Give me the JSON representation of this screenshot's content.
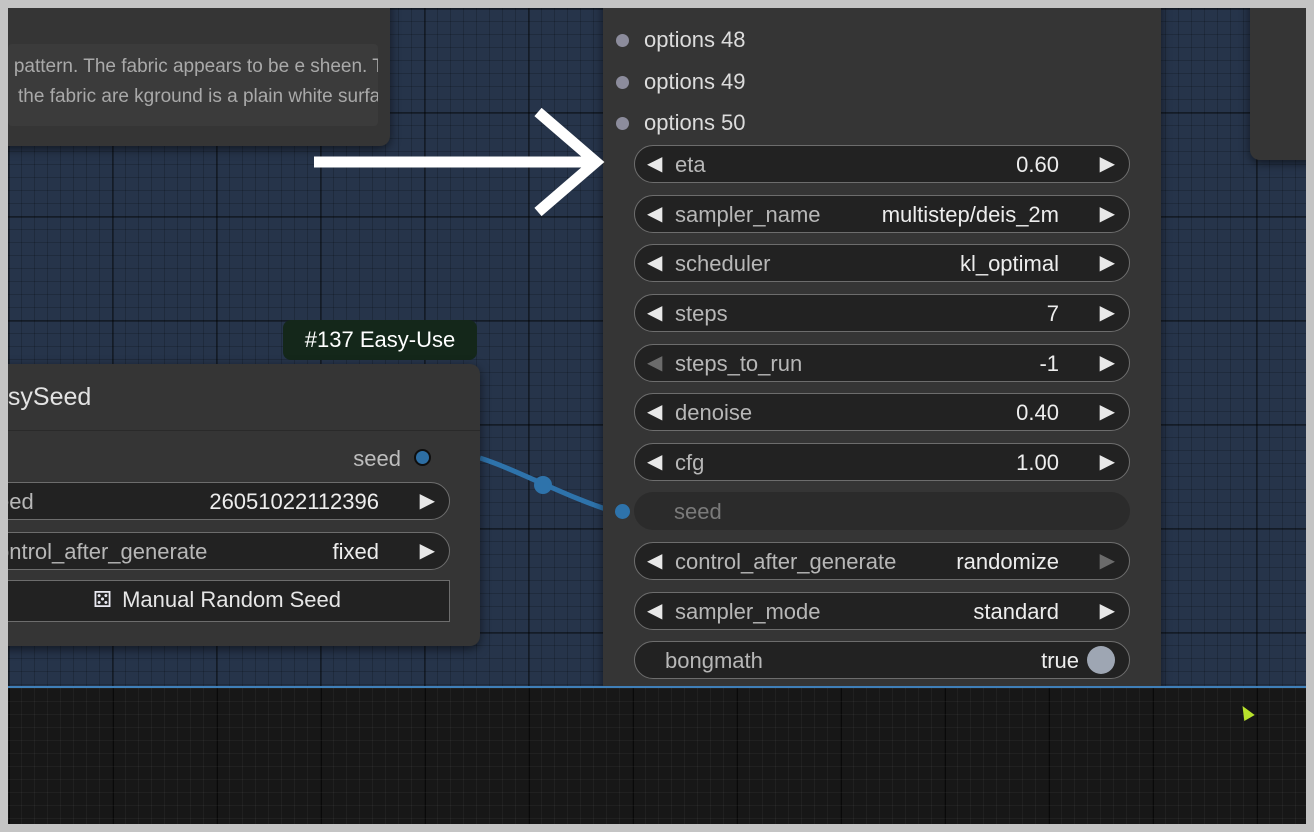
{
  "note_node": {
    "text": "d pattern. The fabric appears to be e sheen. The edges of the fabric are kground is a plain white surface, and"
  },
  "easy_seed_node": {
    "badge": "#137 Easy-Use",
    "title": "asySeed",
    "output_label": "seed",
    "seed_widget": {
      "label": "eed",
      "value": "26051022112396"
    },
    "control_widget": {
      "label": "ontrol_after_generate",
      "value": "fixed"
    },
    "manual_button": "Manual Random Seed",
    "dice_icon": "dice-icon"
  },
  "sampler_node": {
    "options": [
      {
        "label": "options 48"
      },
      {
        "label": "options 49"
      },
      {
        "label": "options 50"
      }
    ],
    "widgets": [
      {
        "label": "eta",
        "value": "0.60"
      },
      {
        "label": "sampler_name",
        "value": "multistep/deis_2m"
      },
      {
        "label": "scheduler",
        "value": "kl_optimal"
      },
      {
        "label": "steps",
        "value": "7"
      },
      {
        "label": "steps_to_run",
        "value": "-1"
      },
      {
        "label": "denoise",
        "value": "0.40"
      },
      {
        "label": "cfg",
        "value": "1.00"
      },
      {
        "label": "seed",
        "value": ""
      },
      {
        "label": "control_after_generate",
        "value": "randomize"
      },
      {
        "label": "sampler_mode",
        "value": "standard"
      },
      {
        "label": "bongmath",
        "value": "true"
      }
    ]
  },
  "colors": {
    "canvas": "#26344a",
    "node": "#353535",
    "link": "#2e73ab",
    "badge": "#14271a",
    "annotation_arrow": "#ffffff"
  },
  "icons": {
    "arrow_left": "◀",
    "arrow_right": "▶"
  }
}
